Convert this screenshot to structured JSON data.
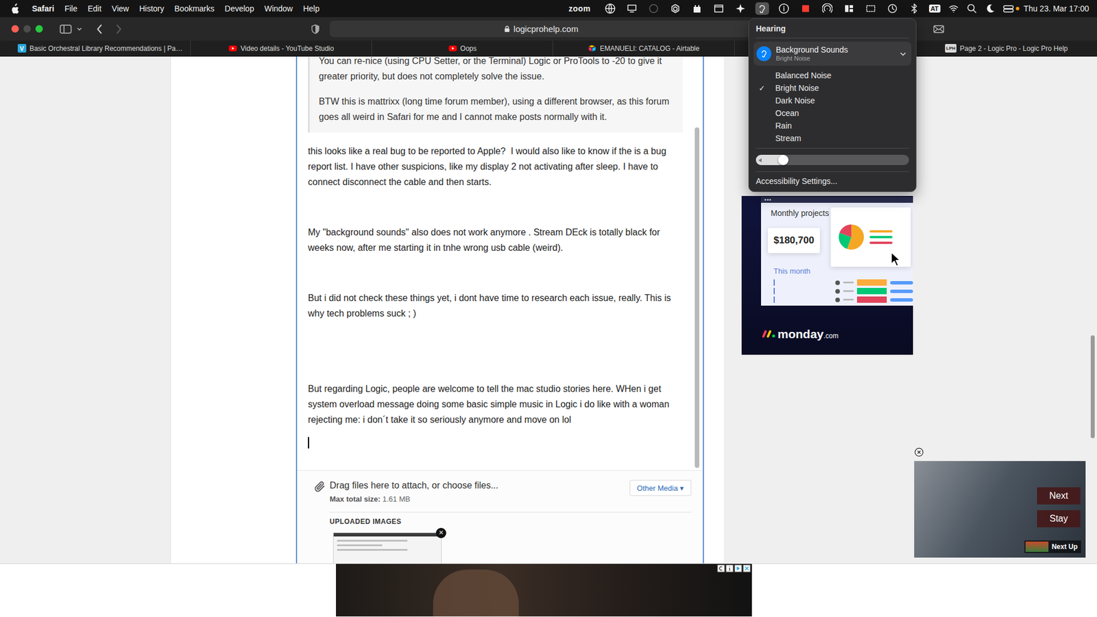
{
  "menubar": {
    "app": "Safari",
    "items": [
      "File",
      "Edit",
      "View",
      "History",
      "Bookmarks",
      "Develop",
      "Window",
      "Help"
    ],
    "status": {
      "zoom": "zoom",
      "input": "AT",
      "clock": "Thu 23. Mar 17:00",
      "hearing_open": true
    }
  },
  "toolbar": {
    "url": "logicprohelp.com"
  },
  "tabs": [
    {
      "label": "Basic Orchestral Library Recommendations | Pa…",
      "favicon": "V",
      "kind": "text",
      "selected": false
    },
    {
      "label": "Video details - YouTube Studio",
      "kind": "youtube",
      "selected": false
    },
    {
      "label": "Oops",
      "kind": "youtube",
      "selected": false
    },
    {
      "label": "EMANUELI: CATALOG - Airtable",
      "kind": "airtable",
      "selected": false
    },
    {
      "label": "Page 2 - Logic Pro - Logic Pro Help",
      "favicon": "LPH",
      "kind": "text",
      "selected": false
    }
  ],
  "post": {
    "quote": [
      "You can re-nice (using CPU Setter, or the Terminal) Logic or ProTools to -20 to give it greater priority, but does not completely solve the issue.",
      "BTW this is mattrixx (long time forum member), using a different browser, as this forum goes all weird in Safari for me and I cannot make posts normally with it."
    ],
    "paragraphs": [
      "this looks like a real bug to be reported to Apple?  I would also like to know if the is a bug report list. I have other suspicions, like my display 2 not activating after sleep. I have to connect disconnect the cable and then starts.",
      "My \"background sounds\" also does not work anymore . Stream DEck is totally black for weeks now, after me starting it in tnhe wrong usb cable (weird).",
      "But i did not check these things yet, i dont have time to research each issue, really. This is why tech problems suck ; )",
      "But regarding Logic, people are welcome to tell the mac studio stories here. WHen i get system overload message doing some basic simple music in Logic i do like with a woman rejecting me: i don´t take it so seriously anymore and move on lol"
    ],
    "cursor": true
  },
  "attachments": {
    "prompt": "Drag files here to attach, or choose files...",
    "limit_label": "Max total size:",
    "limit": "1.61 MB",
    "media_button": "Other Media",
    "media_caret": "▾",
    "uploaded_title": "UPLOADED IMAGES",
    "remove": "×"
  },
  "ad_right": {
    "dots": "•••",
    "title": "Monthly projects",
    "amount": "$180,700",
    "period": "This month",
    "brand": "monday",
    "brand_suffix": ".com",
    "pie": [
      {
        "value": 55,
        "color": "#f5a623"
      },
      {
        "value": 25,
        "color": "#00c875"
      },
      {
        "value": 20,
        "color": "#e2445c"
      }
    ],
    "rows": [
      {
        "color": "#fdab3d"
      },
      {
        "color": "#00c875"
      },
      {
        "color": "#e2445c"
      }
    ]
  },
  "video_ad": {
    "buttons": [
      "Next",
      "Stay"
    ],
    "next_up": "Next Up"
  },
  "hearing_menu": {
    "title": "Hearing",
    "feature": {
      "title": "Background Sounds",
      "subtitle": "Bright Noise",
      "expanded": true
    },
    "options": [
      {
        "label": "Balanced Noise",
        "selected": false
      },
      {
        "label": "Bright Noise",
        "selected": true
      },
      {
        "label": "Dark Noise",
        "selected": false
      },
      {
        "label": "Ocean",
        "selected": false
      },
      {
        "label": "Rain",
        "selected": false
      },
      {
        "label": "Stream",
        "selected": false
      }
    ],
    "check": "✓",
    "volume": {
      "level": 0.18
    },
    "footer": "Accessibility Settings..."
  }
}
